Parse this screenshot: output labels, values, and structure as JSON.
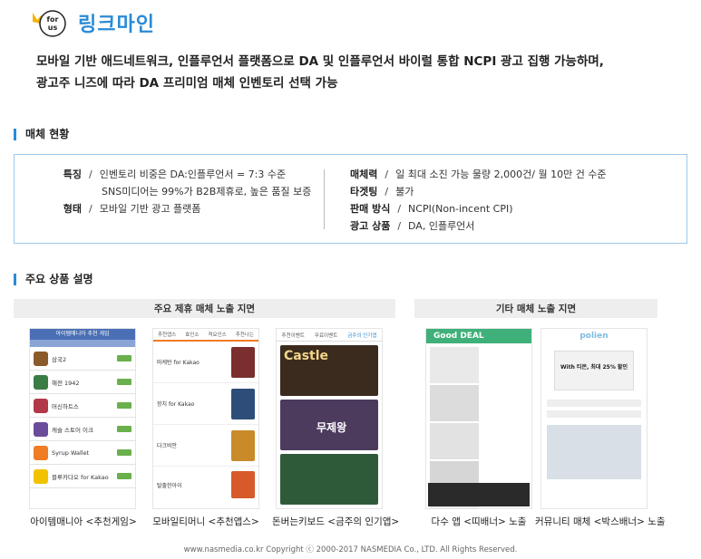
{
  "header": {
    "brand": "링크마인",
    "logo_text": "for us",
    "intro_line1": "모바일 기반 애드네트워크, 인플루언서 플랫폼으로 DA 및 인플루언서 바이럴 통합 NCPI 광고 집행 가능하며,",
    "intro_line2": "광고주 니즈에 따라 DA 프리미엄 매체 인벤토리 선택 가능"
  },
  "media_status": {
    "title": "매체 현황",
    "left": [
      {
        "label": "특징",
        "sep": "/",
        "value": "인벤토리 비중은 DA:인플루언서 = 7:3 수준"
      },
      {
        "label": "",
        "sep": "",
        "value": "SNS미디어는 99%가 B2B제휴로, 높은 품질 보증"
      },
      {
        "label": "형태",
        "sep": "/",
        "value": "모바일 기반 광고 플랫폼"
      }
    ],
    "right": [
      {
        "label": "매체력",
        "sep": "/",
        "value": "일 최대 소진 가능 물량 2,000건/ 월 10만 건 수준"
      },
      {
        "label": "타겟팅",
        "sep": "/",
        "value": "불가"
      },
      {
        "label": "판매 방식",
        "sep": "/",
        "value": "NCPI(Non-incent CPI)"
      },
      {
        "label": "광고 상품",
        "sep": "/",
        "value": "DA, 인플루언서"
      }
    ]
  },
  "products": {
    "title": "주요 상품 설명",
    "group1_title": "주요 제휴 매체 노출 지면",
    "group2_title": "기타 매체 노출 지면",
    "captions": [
      "아이템매니아 <추천게임>",
      "모바일티머니 <추천앱스>",
      "돈버는키보드 <금주의 인기앱>",
      "다수 앱 <띠배너> 노출",
      "커뮤니티 매체 <박스배너> 노출"
    ],
    "shot_texts": {
      "s1_header": "아이템매니아 추천 게임",
      "s1_items": [
        "삼국2",
        "해전 1942",
        "머신하트스",
        "캐슬 스토어 이크",
        "Syrup Wallet",
        "블루카다오 for Kakao"
      ],
      "s2_tabs": [
        "추천앱스",
        "효인소",
        "적요인스",
        "추천나는"
      ],
      "s2_items": [
        "마케턴 for Kakao",
        "항치 for Kakao",
        "다크비안",
        "탈출한아이"
      ],
      "s3_tabs": [
        "추천이벤트",
        "무료이벤트",
        "금주의 인기앱"
      ],
      "s3_banner1": "Castle",
      "s3_banner2": "무제왕",
      "s4_header": "Good DEAL",
      "s5_header": "polien",
      "s5_banner": "With 티몬, 최대 25% 할인"
    }
  },
  "footer": {
    "text": "www.nasmedia.co.kr   Copyright ⓒ 2000-2017   NASMEDIA Co., LTD. All Rights Reserved."
  },
  "colors": {
    "accent": "#2b8bd6",
    "box_border": "#9ec8ea",
    "group_bg": "#eeeeee"
  }
}
